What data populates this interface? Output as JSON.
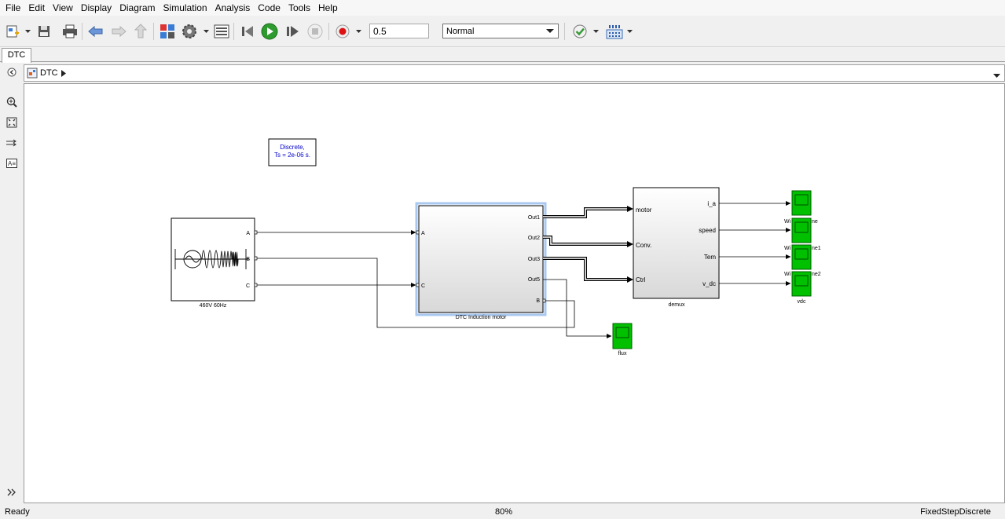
{
  "menu": [
    "File",
    "Edit",
    "View",
    "Display",
    "Diagram",
    "Simulation",
    "Analysis",
    "Code",
    "Tools",
    "Help"
  ],
  "toolbar": {
    "stop_time": "0.5",
    "sim_mode": "Normal"
  },
  "tab": {
    "label": "DTC"
  },
  "address": {
    "path": "DTC"
  },
  "diagram": {
    "powergui": {
      "line1": "Discrete,",
      "line2": "Ts = 2e-06 s."
    },
    "source": {
      "label": "460V 60Hz",
      "ports": [
        "A",
        "B",
        "C"
      ]
    },
    "motor": {
      "label": "DTC Induction motor",
      "in_ports": [
        "A",
        "C"
      ],
      "out_ports": [
        "Out1",
        "Out2",
        "Out3",
        "Out5",
        "B"
      ]
    },
    "demux": {
      "label": "demux",
      "in_ports": [
        "motor",
        "Conv.",
        "Ctrl"
      ],
      "out_ports": [
        "i_a",
        "speed",
        "Tem",
        "v_dc"
      ]
    },
    "scopes": {
      "s1_frag": "Wi",
      "s1_tail": "ne",
      "s2_frag": "Wi",
      "s2_tail": "ne1",
      "s3_frag": "Wi",
      "s3_tail": "ne2",
      "vdc": "vdc",
      "flux": "flux"
    }
  },
  "status": {
    "ready": "Ready",
    "zoom": "80%",
    "solver": "FixedStepDiscrete"
  },
  "colors": {
    "scope_green": "#00c000",
    "canvas": "#ffffff",
    "selection": "#a8c8f0",
    "powergui_text": "#0000cc"
  }
}
